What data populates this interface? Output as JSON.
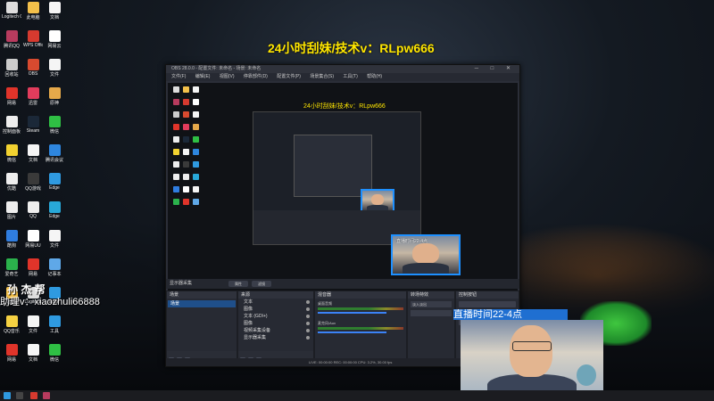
{
  "overlay": {
    "banner": "24小时刮妹/技术v：RLpw666",
    "left_line1": "孙 杰 帮",
    "left_line2": "助理v：xiaozhuli66888",
    "time_label": "直播时间22-4点"
  },
  "nested": {
    "banner": "24小时刮妹/技术v：RLpw666",
    "cam_label": "直播时间22-4点"
  },
  "obs": {
    "title": "OBS 28.0.0 - 配置文件: 未命名 - 场景: 未命名",
    "menu": [
      "文件(F)",
      "编辑(E)",
      "视图(V)",
      "停靠部件(D)",
      "配置文件(P)",
      "场景集合(S)",
      "工具(T)",
      "帮助(H)"
    ],
    "preview_bar": {
      "label": "显示器采集",
      "btn1": "属性",
      "btn2": "滤镜"
    },
    "docks": {
      "scenes": {
        "title": "场景",
        "items": [
          "场景"
        ]
      },
      "sources": {
        "title": "来源",
        "items": [
          "文本",
          "图像",
          "文本 (GDI+)",
          "图像",
          "视频采集设备",
          "显示器采集"
        ]
      },
      "mixer": {
        "title": "混音器",
        "items": [
          "桌面音频",
          "麦克风/Aux"
        ]
      },
      "transitions": {
        "title": "转场特效",
        "selected": "淡入淡出"
      },
      "controls": {
        "title": "控制按钮"
      }
    },
    "status": "LIVE: 00:00:00  REC: 00:00:00  CPU: 3.2%, 30.00 fps"
  },
  "desktop_icons": [
    {
      "label": "Logitech G",
      "color": "#dddddd"
    },
    {
      "label": "此电脑",
      "color": "#f3c04a"
    },
    {
      "label": "文档",
      "color": "#f5f5f5"
    },
    {
      "label": "腾讯QQ",
      "color": "#b83b5e"
    },
    {
      "label": "WPS Office",
      "color": "#d63a2f"
    },
    {
      "label": "网易云",
      "color": "#ffffff"
    },
    {
      "label": "回收站",
      "color": "#cccccc"
    },
    {
      "label": "OBS",
      "color": "#d84a2f"
    },
    {
      "label": "文件",
      "color": "#f5f5f5"
    },
    {
      "label": "网易",
      "color": "#e0342a"
    },
    {
      "label": "迅雷",
      "color": "#e23c5c"
    },
    {
      "label": "原神",
      "color": "#e6a94a"
    },
    {
      "label": "控制面板",
      "color": "#eeeeee"
    },
    {
      "label": "Steam",
      "color": "#1b2838"
    },
    {
      "label": "微信",
      "color": "#2fbf44"
    },
    {
      "label": "微信",
      "color": "#f2d230"
    },
    {
      "label": "文档",
      "color": "#f5f5f5"
    },
    {
      "label": "腾讯会议",
      "color": "#2e86de"
    },
    {
      "label": "优酷",
      "color": "#eeeeee"
    },
    {
      "label": "QQ游戏",
      "color": "#3a3a3a"
    },
    {
      "label": "Edge",
      "color": "#2f9ae0"
    },
    {
      "label": "图片",
      "color": "#eeeeee"
    },
    {
      "label": "QQ",
      "color": "#eeeeee"
    },
    {
      "label": "Edge",
      "color": "#28a8d8"
    },
    {
      "label": "酷狗",
      "color": "#2f7de0"
    },
    {
      "label": "网易UU",
      "color": "#ffffff"
    },
    {
      "label": "文件",
      "color": "#f5f5f5"
    },
    {
      "label": "爱奇艺",
      "color": "#2bb24c"
    },
    {
      "label": "网易",
      "color": "#e0342a"
    },
    {
      "label": "记事本",
      "color": "#5fa8e8"
    },
    {
      "label": "截图",
      "color": "#f3c04a"
    },
    {
      "label": "Logitech",
      "color": "#dddddd"
    },
    {
      "label": "Edge",
      "color": "#2f9ae0"
    },
    {
      "label": "QQ音乐",
      "color": "#f5d142"
    },
    {
      "label": "文件",
      "color": "#f5f5f5"
    },
    {
      "label": "工具",
      "color": "#2f9ae0"
    },
    {
      "label": "网易",
      "color": "#e0342a"
    },
    {
      "label": "文档",
      "color": "#f5f5f5"
    },
    {
      "label": "微信",
      "color": "#2fbf44"
    }
  ]
}
